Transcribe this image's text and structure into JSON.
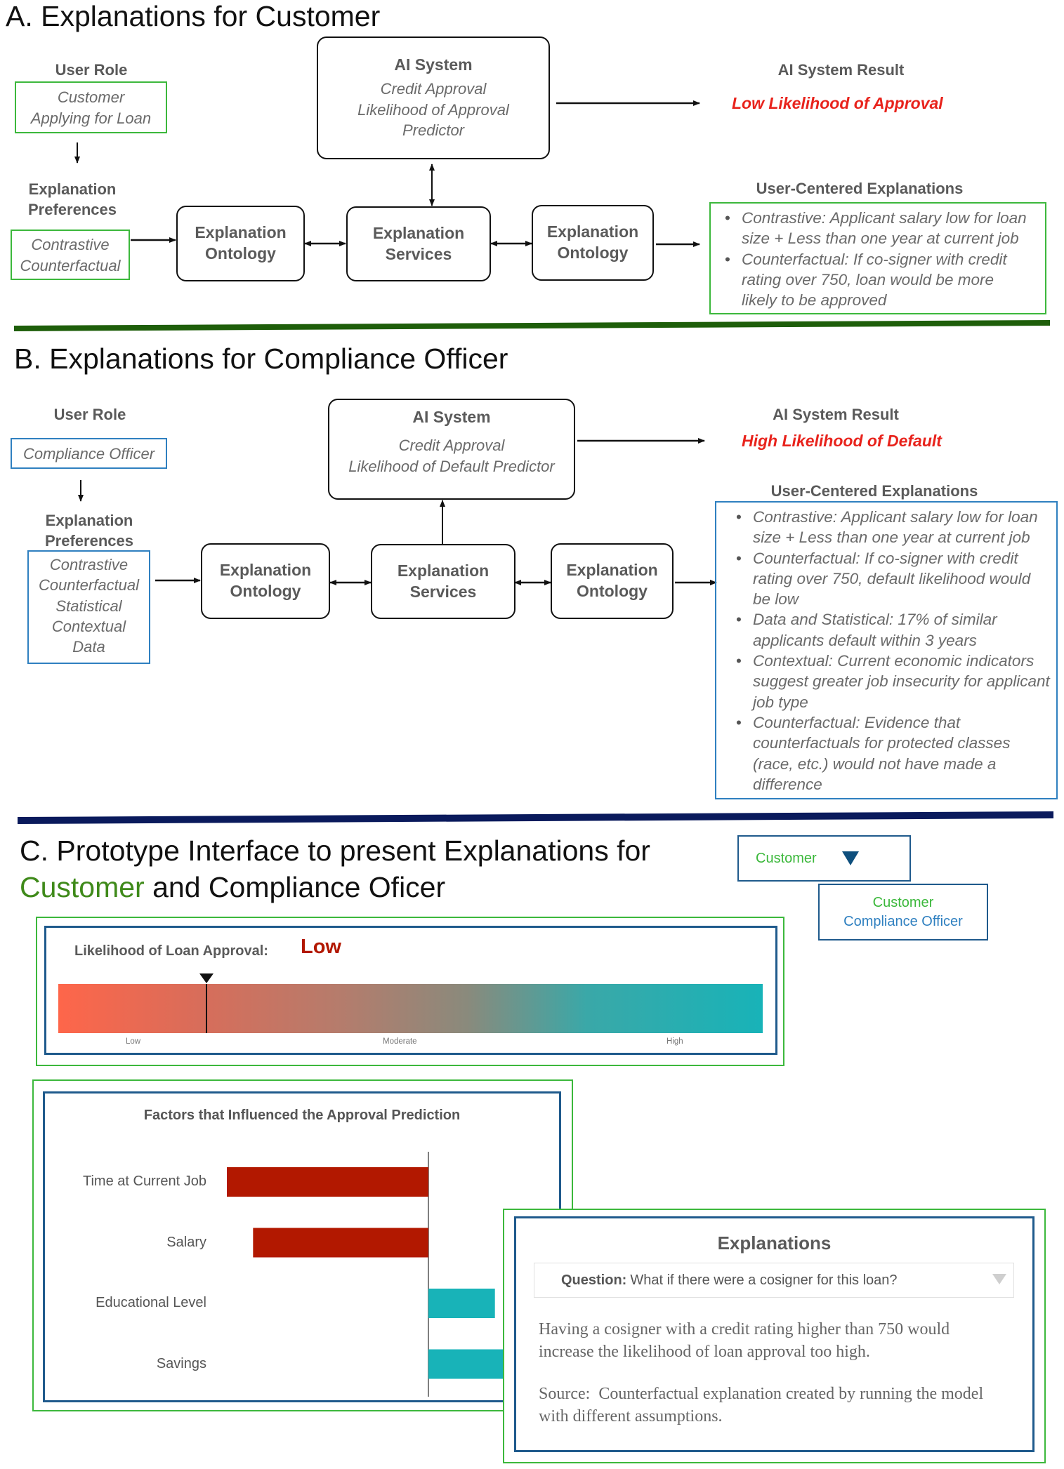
{
  "sectionA": {
    "title": "A. Explanations for Customer",
    "user_role_label": "User Role",
    "user_role_lines": [
      "Customer",
      "Applying for Loan"
    ],
    "pref_label_lines": [
      "Explanation",
      "Preferences"
    ],
    "pref_lines": [
      "Contrastive",
      "Counterfactual"
    ],
    "ai_system_title": "AI System",
    "ai_system_lines": [
      "Credit Approval",
      "Likelihood of Approval",
      "Predictor"
    ],
    "ontology1_lines": [
      "Explanation",
      "Ontology"
    ],
    "services_lines": [
      "Explanation",
      "Services"
    ],
    "ontology2_lines": [
      "Explanation",
      "Ontology"
    ],
    "result_label": "AI System Result",
    "result_value": "Low Likelihood of Approval",
    "explanations_label": "User-Centered Explanations",
    "explanations": [
      "Contrastive: Applicant salary low for loan size + Less than one year at current job",
      "Counterfactual: If co-signer with credit rating over 750, loan would be more likely to be approved"
    ]
  },
  "sectionB": {
    "title": "B. Explanations for Compliance Officer",
    "user_role_label": "User Role",
    "user_role_lines": [
      "Compliance Officer"
    ],
    "pref_label_lines": [
      "Explanation",
      "Preferences"
    ],
    "pref_lines": [
      "Contrastive",
      "Counterfactual",
      "Statistical",
      "Contextual",
      "Data"
    ],
    "ai_system_title": "AI System",
    "ai_system_lines": [
      "Credit Approval",
      "Likelihood of Default Predictor"
    ],
    "ontology1_lines": [
      "Explanation",
      "Ontology"
    ],
    "services_lines": [
      "Explanation",
      "Services"
    ],
    "ontology2_lines": [
      "Explanation",
      "Ontology"
    ],
    "result_label": "AI System Result",
    "result_value": "High Likelihood of Default",
    "explanations_label": "User-Centered Explanations",
    "explanations": [
      "Contrastive: Applicant salary low for loan size + Less than one year at current job",
      "Counterfactual: If co-signer with credit rating over 750, default likelihood would be low",
      "Data and Statistical: 17% of similar applicants default within 3 years",
      "Contextual: Current economic indicators suggest greater job insecurity for applicant job type",
      "Counterfactual: Evidence that counterfactuals for protected classes (race, etc.) would not have made a difference"
    ]
  },
  "sectionC": {
    "title_line1": "C. Prototype Interface to present Explanations for",
    "title_highlight": "Customer",
    "title_rest": " and Compliance Oficer",
    "role_dropdown": {
      "selected": "Customer",
      "options": [
        "Customer",
        "Compliance Officer"
      ]
    },
    "gauge": {
      "label": "Likelihood of Loan Approval:",
      "value_label": "Low",
      "marker_fraction": 0.21,
      "ticks": [
        "Low",
        "Moderate",
        "High"
      ]
    },
    "explanation_panel": {
      "title": "Explanations",
      "question_label": "Question:",
      "question_text": "What if there were a cosigner for this loan?",
      "answer": "Having a cosigner with a credit rating higher than 750 would increase the likelihood of loan approval too high.",
      "source": "Source:  Counterfactual explanation created by running the model with different assumptions."
    }
  },
  "colors": {
    "customer_green": "#3cb83c",
    "officer_blue": "#2f80c0",
    "result_red": "#e8231c",
    "negative_bar": "#b21800",
    "positive_bar": "#18b3b8",
    "divider_green": "#1e5e0a",
    "divider_navy": "#0a1a5c",
    "panel_navy": "#1f5a8c"
  },
  "chart_data": {
    "type": "bar",
    "orientation": "horizontal",
    "title": "Factors that Influenced the Approval Prediction",
    "categories": [
      "Time at Current Job",
      "Salary",
      "Educational Level",
      "Savings"
    ],
    "values": [
      -1.0,
      -0.87,
      0.33,
      0.55
    ],
    "value_units": "relative influence (unlabeled axis; negative = lowers approval)",
    "xlim": [
      -1.0,
      1.0
    ],
    "xlabel": "",
    "ylabel": "",
    "grid": false,
    "legend": "none"
  }
}
